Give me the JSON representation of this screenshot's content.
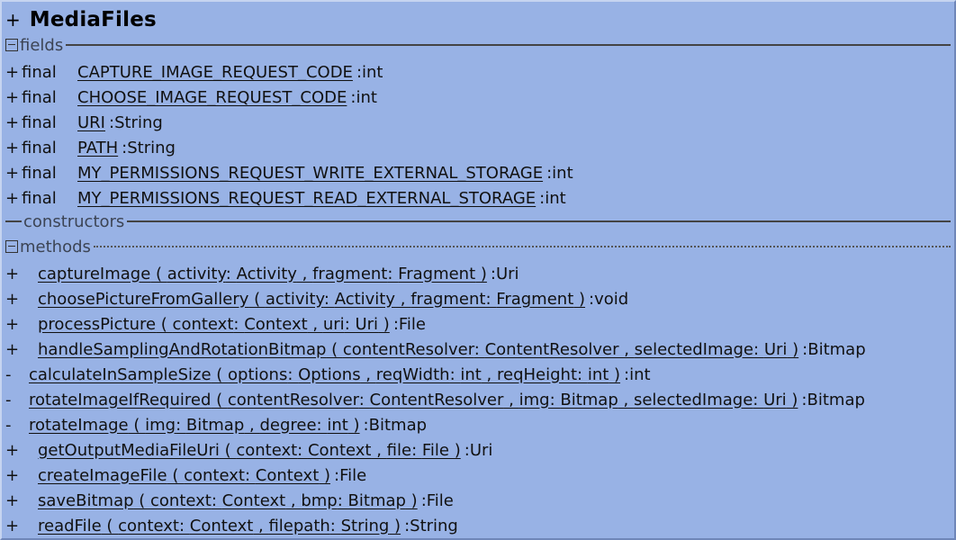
{
  "class": {
    "visibility": "+",
    "name": "MediaFiles"
  },
  "sections": {
    "fields": "fields",
    "constructors": "constructors",
    "methods": "methods"
  },
  "fields": [
    {
      "vis": "+",
      "mod": "final",
      "name": "CAPTURE_IMAGE_REQUEST_CODE",
      "type": "int"
    },
    {
      "vis": "+",
      "mod": "final",
      "name": "CHOOSE_IMAGE_REQUEST_CODE",
      "type": "int"
    },
    {
      "vis": "+",
      "mod": "final",
      "name": "URI",
      "type": "String"
    },
    {
      "vis": "+",
      "mod": "final",
      "name": "PATH",
      "type": "String"
    },
    {
      "vis": "+",
      "mod": "final",
      "name": "MY_PERMISSIONS_REQUEST_WRITE_EXTERNAL_STORAGE",
      "type": "int"
    },
    {
      "vis": "+",
      "mod": "final",
      "name": "MY_PERMISSIONS_REQUEST_READ_EXTERNAL_STORAGE",
      "type": "int"
    }
  ],
  "methods": [
    {
      "vis": "+",
      "name": "captureImage",
      "params": [
        {
          "n": "activity",
          "t": "Activity"
        },
        {
          "n": "fragment",
          "t": "Fragment"
        }
      ],
      "ret": "Uri"
    },
    {
      "vis": "+",
      "name": "choosePictureFromGallery",
      "params": [
        {
          "n": "activity",
          "t": "Activity"
        },
        {
          "n": "fragment",
          "t": "Fragment"
        }
      ],
      "ret": "void"
    },
    {
      "vis": "+",
      "name": "processPicture",
      "params": [
        {
          "n": "context",
          "t": "Context"
        },
        {
          "n": "uri",
          "t": "Uri"
        }
      ],
      "ret": "File"
    },
    {
      "vis": "+",
      "name": "handleSamplingAndRotationBitmap",
      "params": [
        {
          "n": "contentResolver",
          "t": "ContentResolver"
        },
        {
          "n": "selectedImage",
          "t": "Uri"
        }
      ],
      "ret": "Bitmap"
    },
    {
      "vis": "-",
      "name": "calculateInSampleSize",
      "params": [
        {
          "n": "options",
          "t": "Options"
        },
        {
          "n": "reqWidth",
          "t": "int"
        },
        {
          "n": "reqHeight",
          "t": "int"
        }
      ],
      "ret": "int"
    },
    {
      "vis": "-",
      "name": "rotateImageIfRequired",
      "params": [
        {
          "n": "contentResolver",
          "t": "ContentResolver"
        },
        {
          "n": "img",
          "t": "Bitmap"
        },
        {
          "n": "selectedImage",
          "t": "Uri"
        }
      ],
      "ret": "Bitmap"
    },
    {
      "vis": "-",
      "name": "rotateImage",
      "params": [
        {
          "n": "img",
          "t": "Bitmap"
        },
        {
          "n": "degree",
          "t": "int"
        }
      ],
      "ret": "Bitmap"
    },
    {
      "vis": "+",
      "name": "getOutputMediaFileUri",
      "params": [
        {
          "n": "context",
          "t": "Context"
        },
        {
          "n": "file",
          "t": "File"
        }
      ],
      "ret": "Uri"
    },
    {
      "vis": "+",
      "name": "createImageFile",
      "params": [
        {
          "n": "context",
          "t": "Context"
        }
      ],
      "ret": "File"
    },
    {
      "vis": "+",
      "name": "saveBitmap",
      "params": [
        {
          "n": "context",
          "t": "Context"
        },
        {
          "n": "bmp",
          "t": "Bitmap"
        }
      ],
      "ret": "File"
    },
    {
      "vis": "+",
      "name": "readFile",
      "params": [
        {
          "n": "context",
          "t": "Context"
        },
        {
          "n": "filepath",
          "t": "String"
        }
      ],
      "ret": "String"
    }
  ]
}
